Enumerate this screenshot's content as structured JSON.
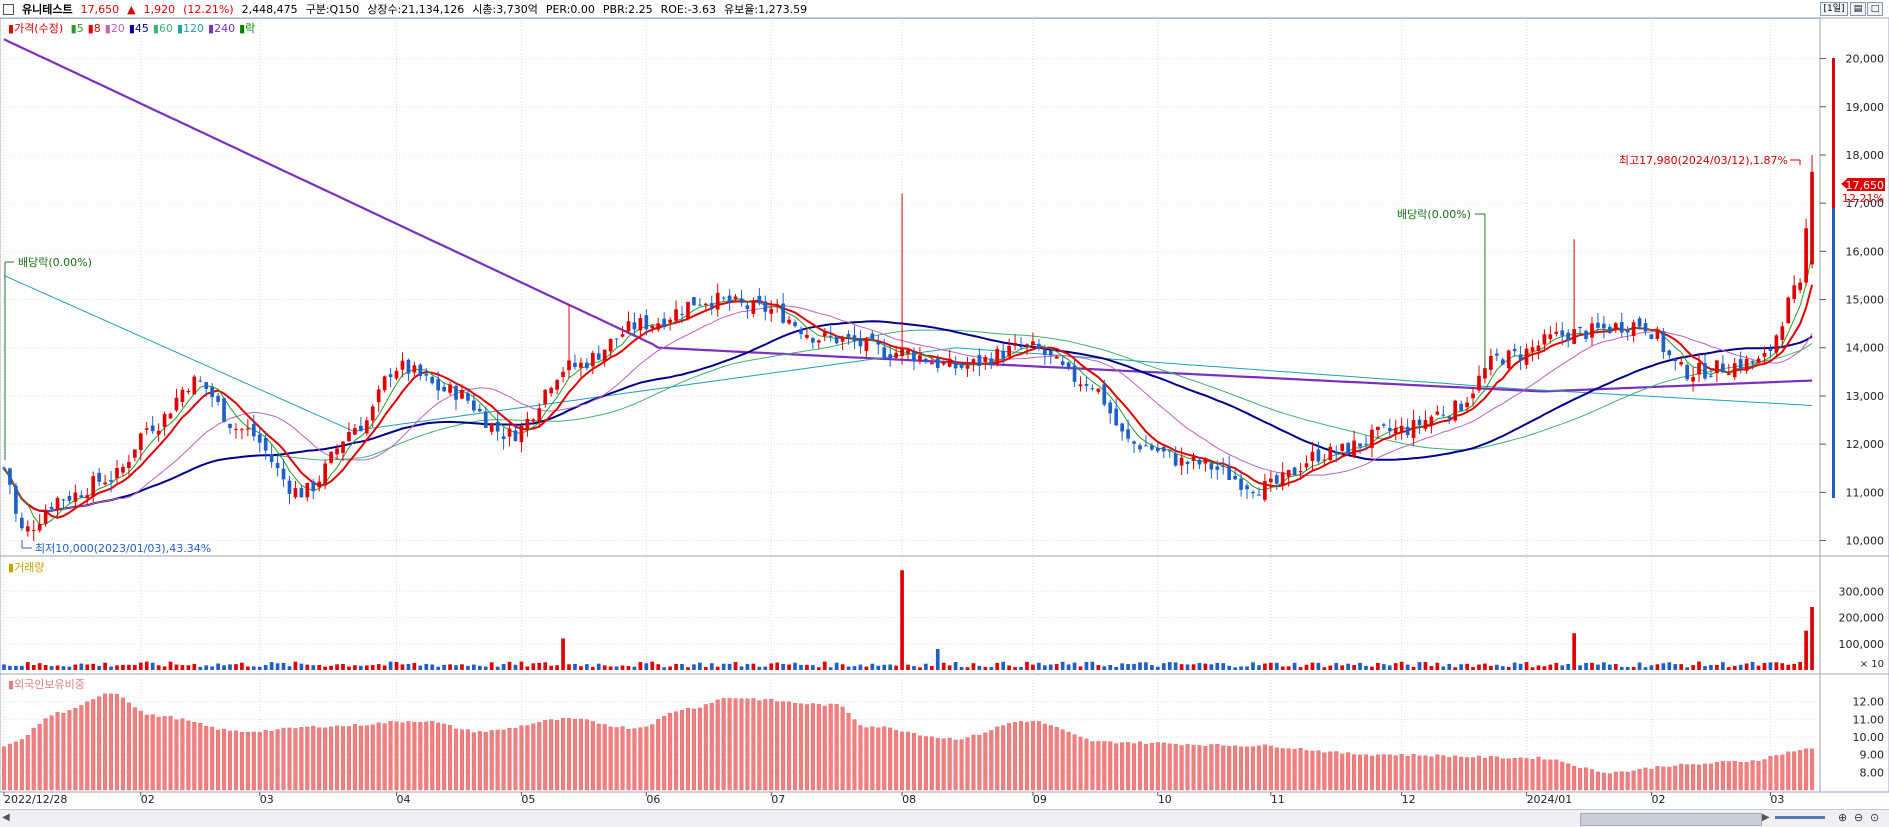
{
  "header": {
    "name": "유니테스트",
    "price": "17,650",
    "change_arrow": "▲",
    "change": "1,920",
    "change_pct": "(12.21%)",
    "volume": "2,448,475",
    "market": "구분:Q150",
    "shares": "상장수:21,134,126",
    "mcap": "시총:3,730억",
    "per": "PER:0.00",
    "pbr": "PBR:2.25",
    "roe": "ROE:-3.63",
    "reserve": "유보율:1,273.59",
    "period_btn": "[1일]",
    "win_btns": [
      "▤",
      "□"
    ]
  },
  "legend": {
    "price_label": "가격(수정)",
    "ma": [
      {
        "label": "5",
        "color": "#2a9a2a"
      },
      {
        "label": "8",
        "color": "#e00000"
      },
      {
        "label": "20",
        "color": "#c060c0"
      },
      {
        "label": "45",
        "color": "#00008b"
      },
      {
        "label": "60",
        "color": "#3cb371"
      },
      {
        "label": "120",
        "color": "#20a0b0"
      },
      {
        "label": "240",
        "color": "#7b2fbf"
      },
      {
        "label": "락",
        "color": "#008000"
      }
    ],
    "volume_label": "거래량",
    "foreign_label": "외국인보유비중"
  },
  "annotations": {
    "high": "최고17,980(2024/03/12),1.87%",
    "low": "최저10,000(2023/01/03),43.34%",
    "div1": "배당락(0.00%)",
    "div2": "배당락(0.00%)",
    "last_price": "17,650",
    "last_pct": "12.21%"
  },
  "colors": {
    "up": "#e00000",
    "down": "#1f5fc8",
    "ma5": "#2a9a2a",
    "ma8": "#e00000",
    "ma20": "#c060c0",
    "ma45": "#00008b",
    "ma60": "#3cb371",
    "ma120": "#20a0b0",
    "ma240": "#7b2fbf",
    "foreign": "#f08080"
  },
  "chart_data": [
    {
      "type": "candlestick",
      "title": "가격(수정)",
      "ylim": [
        9700,
        20800
      ],
      "y_ticks": [
        "20,000",
        "19,000",
        "18,000",
        "17,000",
        "16,000",
        "15,000",
        "14,000",
        "13,000",
        "12,000",
        "11,000",
        "10,000"
      ],
      "y_tick_values": [
        20000,
        19000,
        18000,
        17000,
        16000,
        15000,
        14000,
        13000,
        12000,
        11000,
        10000
      ],
      "x_ticks": [
        "2022/12/28",
        "02",
        "03",
        "04",
        "05",
        "06",
        "07",
        "08",
        "09",
        "10",
        "11",
        "12",
        "2024/01",
        "02",
        "03"
      ],
      "x_tick_index": [
        0,
        23,
        43,
        66,
        87,
        108,
        129,
        151,
        173,
        194,
        213,
        235,
        256,
        277,
        297
      ],
      "n": 305,
      "anchors": [
        [
          0,
          11500
        ],
        [
          3,
          10200
        ],
        [
          10,
          10900
        ],
        [
          18,
          11300
        ],
        [
          25,
          12400
        ],
        [
          32,
          13300
        ],
        [
          40,
          12300
        ],
        [
          50,
          11000
        ],
        [
          60,
          12400
        ],
        [
          66,
          13600
        ],
        [
          75,
          13100
        ],
        [
          85,
          12200
        ],
        [
          95,
          13600
        ],
        [
          108,
          14500
        ],
        [
          118,
          15000
        ],
        [
          128,
          14800
        ],
        [
          138,
          14200
        ],
        [
          151,
          13900
        ],
        [
          160,
          13600
        ],
        [
          172,
          14000
        ],
        [
          182,
          13300
        ],
        [
          190,
          12000
        ],
        [
          200,
          11600
        ],
        [
          212,
          11100
        ],
        [
          222,
          11800
        ],
        [
          235,
          12300
        ],
        [
          243,
          12700
        ],
        [
          252,
          13800
        ],
        [
          264,
          14300
        ],
        [
          275,
          14500
        ],
        [
          283,
          13500
        ],
        [
          295,
          13700
        ],
        [
          302,
          15200
        ],
        [
          304,
          17650
        ]
      ],
      "volume_ylim": [
        0,
        400000
      ],
      "volume_ticks": [
        "300,000",
        "200,000",
        "100,000"
      ],
      "volume_tick_values": [
        300000,
        200000,
        100000
      ],
      "volume_unit": "× 10",
      "volume_spikes": [
        [
          94,
          120000
        ],
        [
          151,
          380000
        ],
        [
          157,
          80000
        ],
        [
          264,
          140000
        ],
        [
          303,
          150000
        ],
        [
          304,
          240000
        ]
      ],
      "foreign_ylim": [
        7,
        13
      ],
      "foreign_ticks": [
        "12.00",
        "11.00",
        "10.00",
        "9.00",
        "8.00"
      ],
      "foreign_tick_values": [
        12,
        11,
        10,
        9,
        8
      ],
      "foreign_anchors": [
        [
          0,
          9.5
        ],
        [
          10,
          11.4
        ],
        [
          18,
          12.5
        ],
        [
          25,
          11.2
        ],
        [
          40,
          10.3
        ],
        [
          55,
          10.6
        ],
        [
          70,
          10.9
        ],
        [
          80,
          10.3
        ],
        [
          95,
          11.0
        ],
        [
          106,
          10.5
        ],
        [
          115,
          11.6
        ],
        [
          122,
          12.2
        ],
        [
          140,
          11.8
        ],
        [
          145,
          10.6
        ],
        [
          160,
          9.9
        ],
        [
          172,
          10.9
        ],
        [
          185,
          9.7
        ],
        [
          210,
          9.5
        ],
        [
          230,
          9.0
        ],
        [
          258,
          8.8
        ],
        [
          270,
          8.0
        ],
        [
          282,
          8.4
        ],
        [
          292,
          8.6
        ],
        [
          304,
          9.3
        ]
      ]
    }
  ]
}
